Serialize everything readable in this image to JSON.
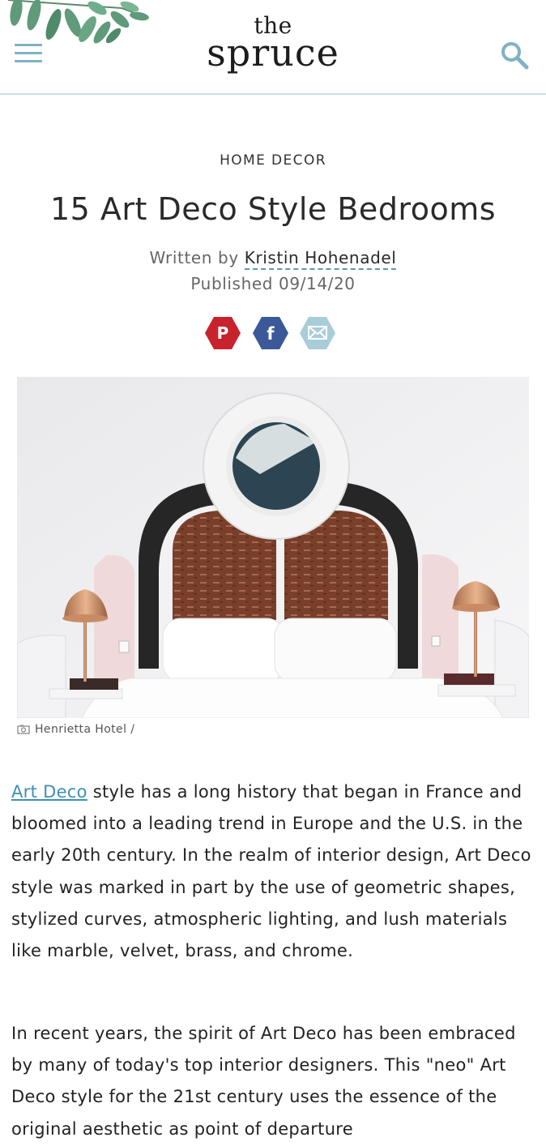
{
  "header": {
    "logo_the": "the",
    "logo_spruce": "spruce",
    "menu_icon": "hamburger-menu-icon",
    "search_icon": "search-icon"
  },
  "article": {
    "category": "HOME DECOR",
    "title": "15 Art Deco Style Bedrooms",
    "byline_prefix": "Written by",
    "author": "Kristin Hohenadel",
    "published": "Published 09/14/20"
  },
  "social": [
    {
      "name": "pinterest",
      "icon": "pinterest-icon",
      "color": "#c8232c"
    },
    {
      "name": "facebook",
      "icon": "facebook-icon",
      "color": "#3b5998"
    },
    {
      "name": "email",
      "icon": "email-icon",
      "color": "#a9ccd9"
    }
  ],
  "image": {
    "caption": "Henrietta Hotel /",
    "caption_icon": "camera-icon"
  },
  "body": {
    "p1_link": "Art Deco",
    "p1_text": " style has a long history that began in France and bloomed into a leading trend in Europe and the U.S. in the early 20th century. In the realm of interior design, Art Deco style was marked in part by the use of geometric shapes, stylized curves, atmospheric lighting, and lush materials like marble, velvet, brass, and chrome.",
    "p2_text": "In recent years, the spirit of Art Deco has been embraced by many of today's top interior designers. This \"neo\" Art Deco style for the 21st century uses the essence of the original aesthetic as point of departure"
  },
  "colors": {
    "accent": "#7fb1c4",
    "link": "#3f8fb3",
    "header_border": "#c9dce3"
  }
}
